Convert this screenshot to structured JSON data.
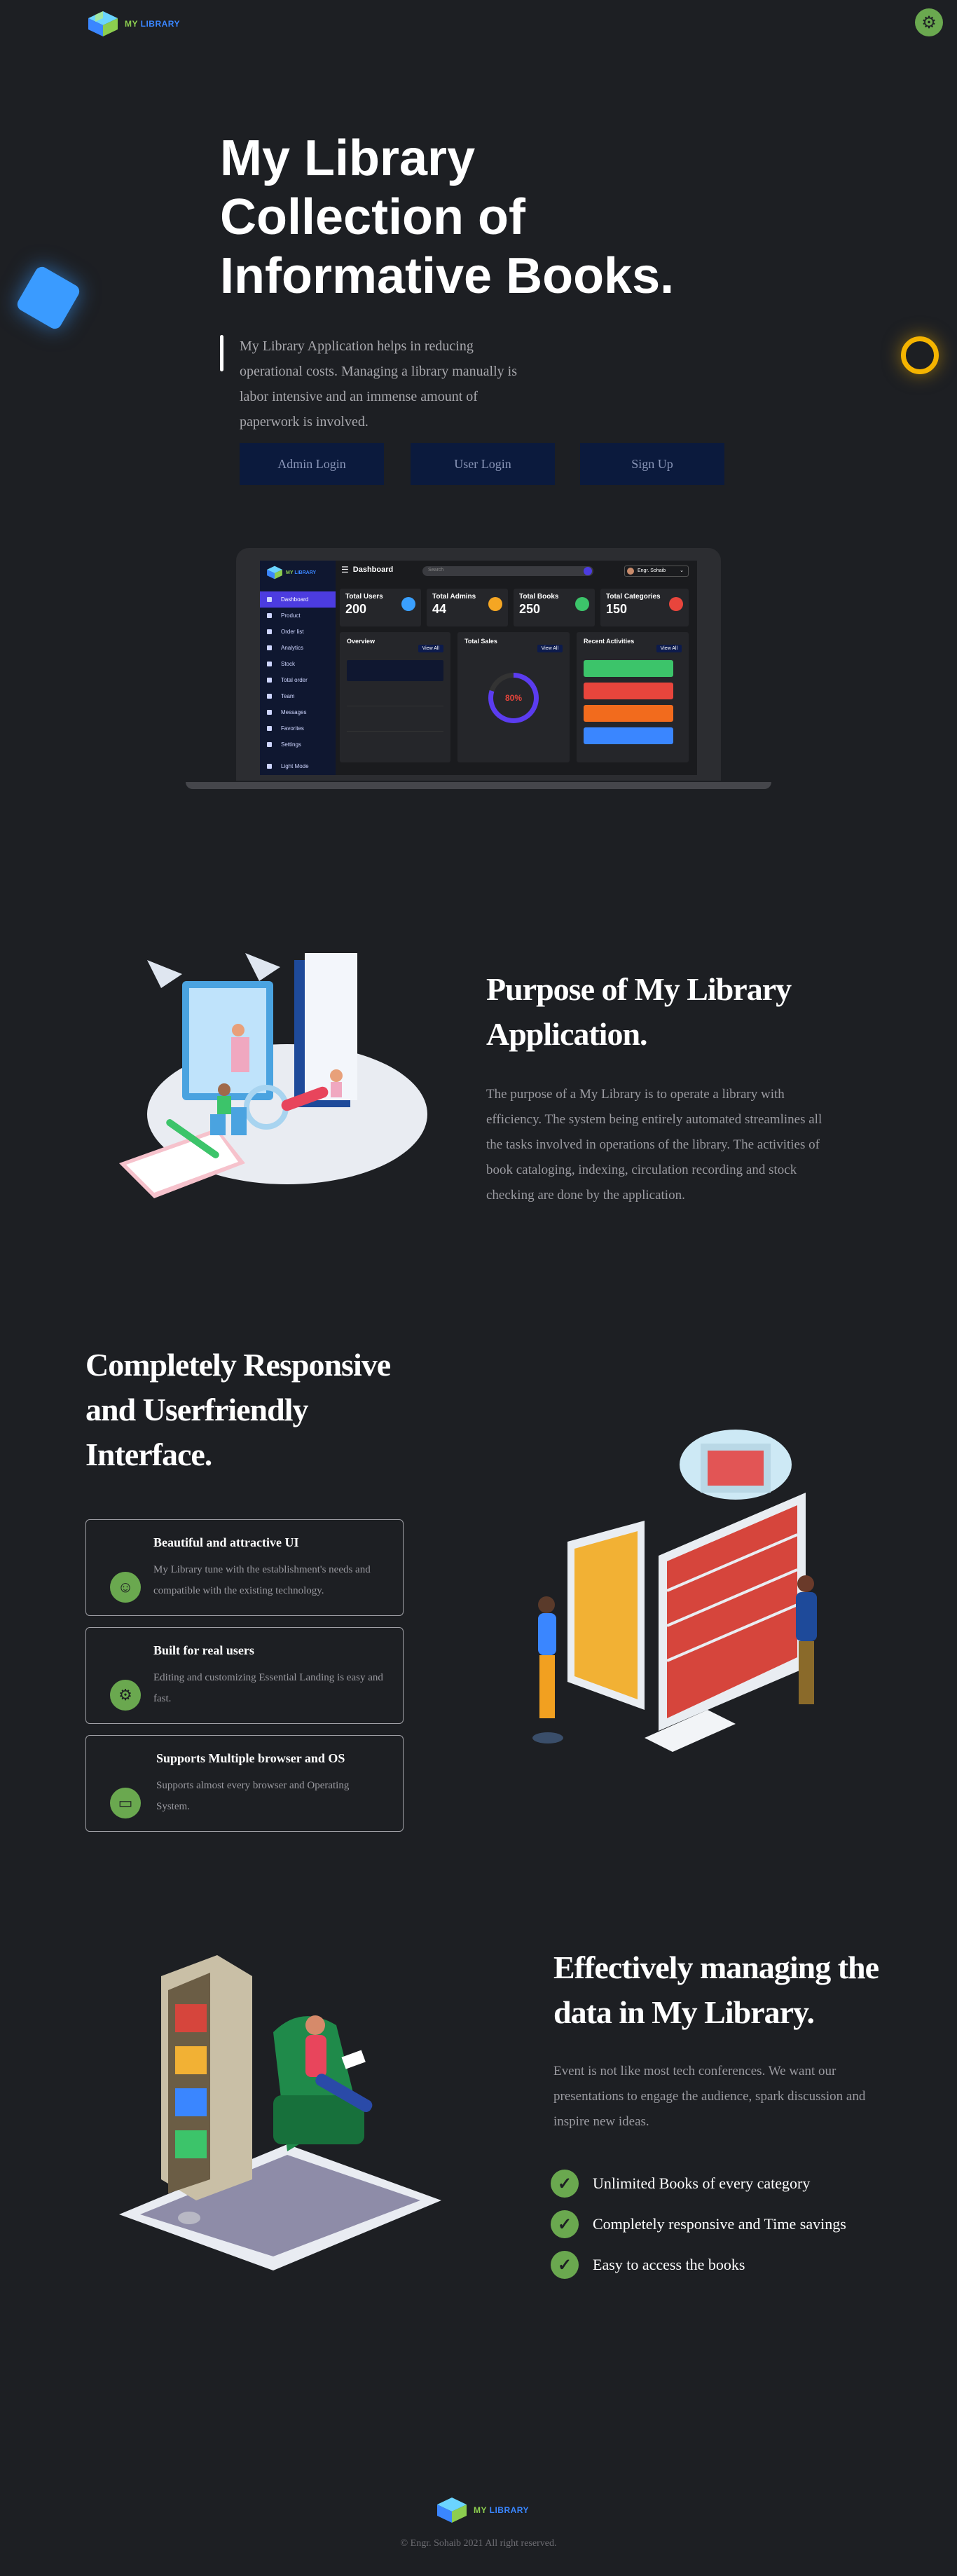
{
  "header": {
    "logo_text_a": "MY ",
    "logo_text_b": "LIBRARY",
    "settings_icon": "gear-icon"
  },
  "hero": {
    "title_lines": [
      "My Library",
      "Collection of",
      "Informative Books."
    ],
    "description": "My Library Application helps in reducing operational costs. Managing a library manually is labor intensive and an immense amount of paperwork is involved.",
    "buttons": {
      "admin_login": "Admin Login",
      "user_login": "User Login",
      "sign_up": "Sign Up"
    }
  },
  "dashboard_preview": {
    "title": "Dashboard",
    "search_placeholder": "Search",
    "user_name": "Engr. Sohaib",
    "sidebar_items": [
      "Dashboard",
      "Product",
      "Order list",
      "Analytics",
      "Stock",
      "Total order",
      "Team",
      "Messages",
      "Favorites",
      "Settings",
      "Light Mode"
    ],
    "stats": [
      {
        "title": "Total Users",
        "value": "200",
        "color": "#3aa0ff"
      },
      {
        "title": "Total Admins",
        "value": "44",
        "color": "#f5a623"
      },
      {
        "title": "Total Books",
        "value": "250",
        "color": "#3cc46a"
      },
      {
        "title": "Total Categories",
        "value": "150",
        "color": "#e8453c"
      }
    ],
    "panels": {
      "overview": "Overview",
      "total_sales": "Total Sales",
      "recent_activities": "Recent Activities",
      "view_all": "View All",
      "sales_percent": "80%"
    },
    "activity_colors": [
      "#3cc46a",
      "#e8453c",
      "#f26b1d",
      "#3a86ff"
    ]
  },
  "purpose": {
    "title": "Purpose of My Library Application.",
    "description": "The purpose of a My Library is to operate a library with efficiency. The system being entirely automated streamlines all the tasks involved in operations of the library. The activities of book cataloging, indexing, circulation recording and stock checking are done by the application."
  },
  "responsive": {
    "title": "Completely Responsive and Userfriendly Interface.",
    "features": [
      {
        "icon": "smile-icon",
        "title": "Beautiful and attractive UI",
        "description": "My Library tune with the establishment's needs and compatible with the existing technology."
      },
      {
        "icon": "gear-icon",
        "title": "Built for real users",
        "description": "Editing and customizing Essential Landing is easy and fast."
      },
      {
        "icon": "monitor-icon",
        "title": "Supports Multiple browser and OS",
        "description": "Supports almost every browser and Operating System."
      }
    ]
  },
  "managing": {
    "title": "Effectively managing the data in My Library.",
    "description": "Event is not like most tech conferences. We want our presentations to engage the audience, spark discussion and inspire new ideas.",
    "checks": [
      "Unlimited Books of every category",
      "Completely responsive and Time savings",
      "Easy to access the books"
    ]
  },
  "footer": {
    "copyright": "© Engr. Sohaib 2021 All right reserved."
  },
  "colors": {
    "background": "#1d1f23",
    "accent_green": "#6aa84f",
    "button_navy": "#0b1a3d",
    "deco_blue": "#3a9bff",
    "deco_yellow": "#f5b400"
  }
}
